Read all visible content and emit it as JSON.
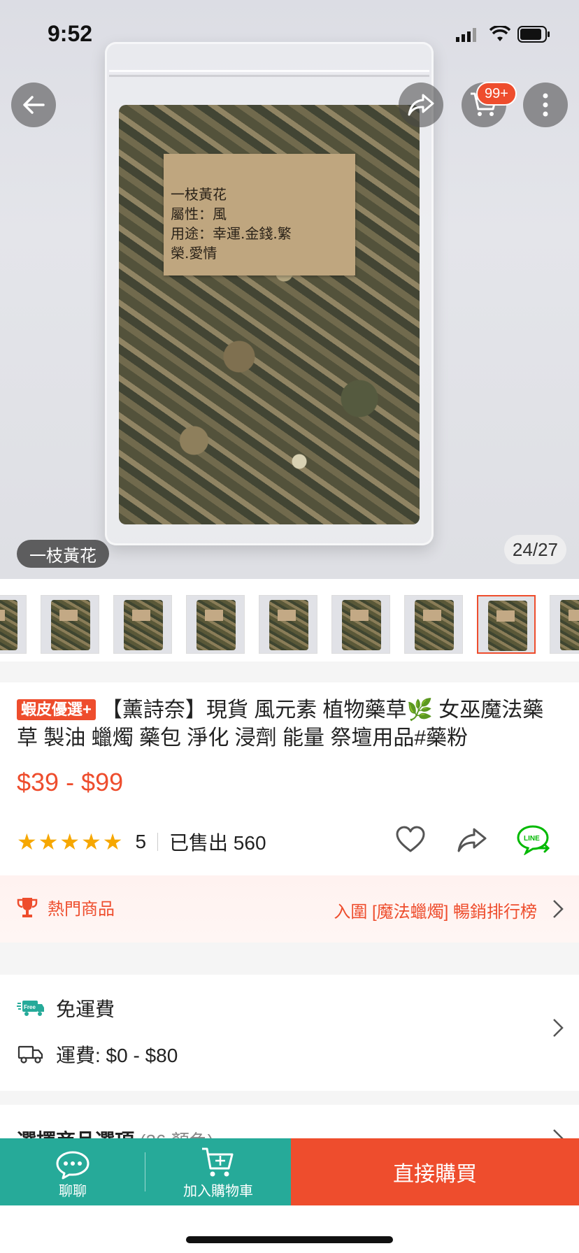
{
  "status_bar": {
    "time": "9:52"
  },
  "hero": {
    "label_lines": [
      "一枝黃花",
      "屬性：風",
      "用途：幸運.金錢.繁",
      "榮.愛情"
    ],
    "caption": "一枝黃花",
    "counter": "24/27",
    "cart_badge": "99+"
  },
  "thumbnails": {
    "count": 9,
    "active_index": 7
  },
  "product": {
    "tag": "蝦皮優選+",
    "title": "【薰詩奈】現貨 風元素 植物藥草🌿 女巫魔法藥草 製油 蠟燭 藥包 淨化 浸劑 能量 祭壇用品#藥粉",
    "price": "$39 - $99",
    "rating": "5",
    "sold": "已售出 560",
    "star_color": "#f6a700"
  },
  "hot": {
    "label": "熱門商品",
    "ranking": "入圍 [魔法蠟燭] 暢銷排行榜"
  },
  "shipping": {
    "free": "免運費",
    "fee": "運費: $0 - $80"
  },
  "options": {
    "title": "選擇商品選項",
    "sub": "(26 顏色)"
  },
  "bottom_bar": {
    "chat": "聊聊",
    "add_to_cart": "加入購物車",
    "buy_now": "直接購買"
  },
  "colors": {
    "accent": "#ee4d2d",
    "teal": "#26aa99",
    "line_green": "#00b900"
  }
}
